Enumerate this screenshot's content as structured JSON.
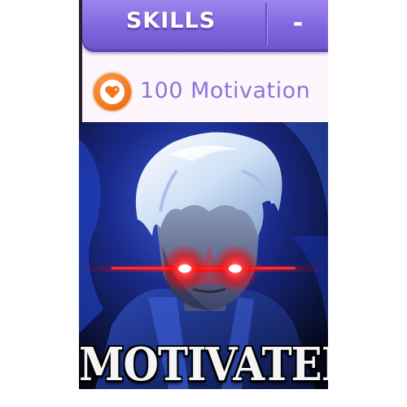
{
  "skills_header": {
    "title": "SKILLS",
    "collapse_symbol": "-"
  },
  "motivation": {
    "text": "100 Motivation",
    "icon": "heart-icon"
  },
  "meme": {
    "caption": "MOTIVATED",
    "image": "character-glowing-red-eyes"
  },
  "colors": {
    "header_purple": "#7f65dd",
    "motivation_text": "#8d73da",
    "heart_orange": "#f07a23",
    "eye_glow": "#ff1a1a",
    "hair": "#dfe8f8",
    "background_blue": "#1a2a7a"
  }
}
